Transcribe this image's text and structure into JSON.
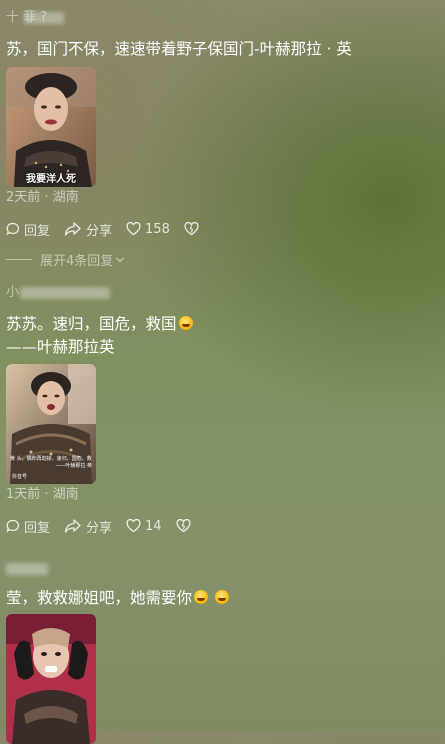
{
  "comments": [
    {
      "username": "十 菲 ?",
      "text": "苏，国门不保，速速带着野子保国门-叶赫那拉 · 英",
      "image_caption": "我要洋人死",
      "meta": "2天前 · 湖南",
      "reply_label": "回复",
      "share_label": "分享",
      "like_count": "158"
    },
    {
      "username": "小",
      "text": "苏苏。速归，国危，救国",
      "text_line2": "——叶赫那拉英",
      "image_subtitle": "黄 头，偶你再劫掠，速归，国危，救",
      "image_subtitle2": "——叶赫那拉·英",
      "image_watermark": "抖音号",
      "meta": "1天前 · 湖南",
      "reply_label": "回复",
      "share_label": "分享",
      "like_count": "14"
    },
    {
      "username": "",
      "text": "莹，救救娜姐吧，她需要你"
    }
  ],
  "expand_replies": "展开4条回复",
  "icons": {
    "reply": "comment-bubble-icon",
    "share": "share-arrow-icon",
    "like": "heart-icon",
    "dislike": "broken-heart-icon",
    "expand": "chevron-down-icon",
    "emoji_smile": "smiling-face-emoji",
    "emoji_laugh": "rolling-laughing-emoji"
  }
}
